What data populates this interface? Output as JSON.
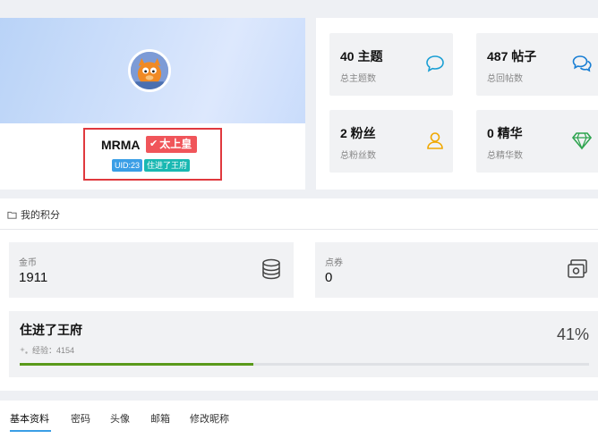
{
  "profile": {
    "username": "MRMA",
    "rank_badge": "太上皇",
    "uid_tag": "UID:23",
    "level_tag": "住进了王府"
  },
  "stats": [
    {
      "value": "40 主题",
      "label": "总主题数",
      "icon": "chat-bubble-icon",
      "color": "#1a9fd4"
    },
    {
      "value": "487 帖子",
      "label": "总回帖数",
      "icon": "chat-bubbles-icon",
      "color": "#1a7fd4"
    },
    {
      "value": "2 粉丝",
      "label": "总粉丝数",
      "icon": "user-icon",
      "color": "#f0a800"
    },
    {
      "value": "0 精华",
      "label": "总精华数",
      "icon": "diamond-icon",
      "color": "#2ea44f"
    }
  ],
  "points": {
    "section_title": "我的积分",
    "gold": {
      "label": "金币",
      "value": "1911",
      "icon": "coins-icon"
    },
    "coupon": {
      "label": "点券",
      "value": "0",
      "icon": "coupon-icon"
    }
  },
  "level": {
    "name": "住进了王府",
    "exp_text": "经验：4154",
    "percent_text": "41%",
    "progress": 0.41,
    "accent": "#5a9a1b"
  },
  "tabs": [
    {
      "label": "基本资料",
      "active": true
    },
    {
      "label": "密码",
      "active": false
    },
    {
      "label": "头像",
      "active": false
    },
    {
      "label": "邮箱",
      "active": false
    },
    {
      "label": "修改昵称",
      "active": false
    }
  ]
}
